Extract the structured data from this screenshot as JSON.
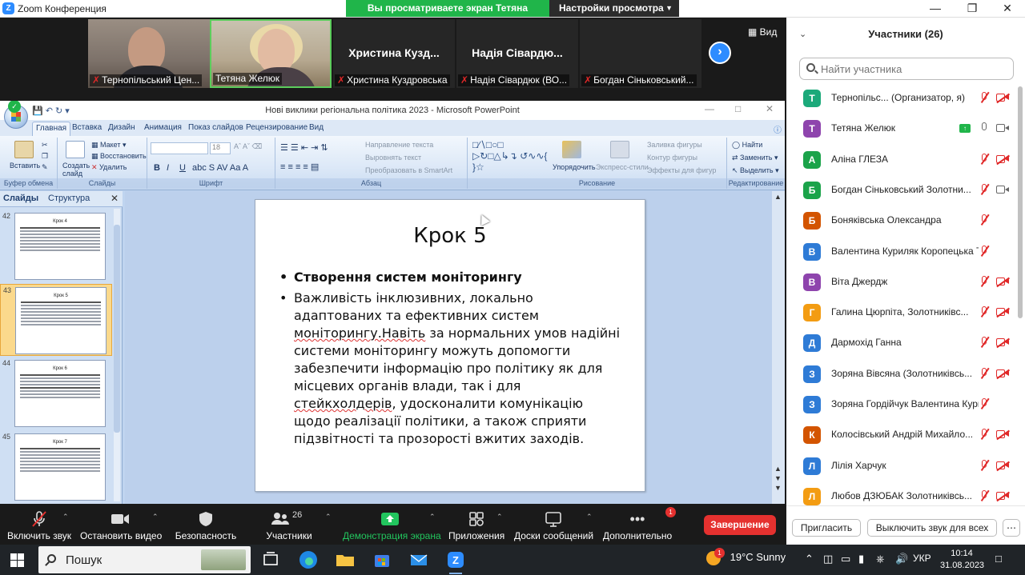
{
  "app": {
    "title": "Zoom Конференция",
    "share_banner": "Вы просматриваете экран Тетяна Желюк",
    "view_settings": "Настройки просмотра"
  },
  "video_strip": {
    "tiles": [
      {
        "name": "Тернопільський Цен..."
      },
      {
        "name": "Тетяна Желюк"
      },
      {
        "name": "Христина Куздровська",
        "big": "Христина Куздровська"
      },
      {
        "name": "Надія Сівардюк (ВО...",
        "big": "Надія Сівардюк ..."
      },
      {
        "name": "Богдан Сіньковський..."
      }
    ],
    "big_name_3": "Христина Кузд...",
    "big_name_4": "Надія Сівардю...",
    "view_label": "Вид"
  },
  "ppt": {
    "window_title": "Нові виклики регіональна політика 2023 - Microsoft PowerPoint",
    "tabs": [
      "Главная",
      "Вставка",
      "Дизайн",
      "Анимация",
      "Показ слайдов",
      "Рецензирование",
      "Вид"
    ],
    "ribbon": {
      "paste": "Вставить",
      "create_slide": "Создать слайд",
      "layout": "Макет",
      "restore": "Восстановить",
      "delete": "Удалить",
      "font_size": "18",
      "text_direction": "Направление текста",
      "align_text": "Выровнять текст",
      "convert_smartart": "Преобразовать в SmartArt",
      "arrange": "Упорядочить",
      "express_styles": "Экспресс-стили",
      "shape_fill": "Заливка фигуры",
      "shape_outline": "Контур фигуры",
      "shape_effects": "Эффекты для фигур",
      "find": "Найти",
      "replace": "Заменить",
      "select": "Выделить",
      "groups": [
        "Буфер обмена",
        "Слайды",
        "Шрифт",
        "Абзац",
        "Рисование",
        "Редактирование"
      ]
    },
    "slides_tabs": [
      "Слайды",
      "Структура"
    ],
    "thumbnails": [
      {
        "num": "42",
        "title": "Крок 4"
      },
      {
        "num": "43",
        "title": "Крок 5"
      },
      {
        "num": "44",
        "title": "Крок 6"
      },
      {
        "num": "45",
        "title": "Крок 7"
      }
    ],
    "slide": {
      "title": "Крок 5",
      "bullet1": "Створення систем моніторингу",
      "bullet2_part1": "Важливість інклюзивних, локально адаптованих та ефективних систем ",
      "bullet2_u1": "моніторингу.Навіть",
      "bullet2_part2": " за нормальних умов надійні системи моніторингу можуть допомогти забезпечити інформацію про політику як для місцевих органів влади, так і для ",
      "bullet2_u2": "стейкхолдерів",
      "bullet2_part3": ", удосконалити комунікацію щодо реалізації політики, а також сприяти підзвітності та прозорості вжитих заходів."
    }
  },
  "participants": {
    "title": "Участники (26)",
    "search_placeholder": "Найти участника",
    "list": [
      {
        "initial": "Т",
        "color": "#1ba97a",
        "name": "Тернопільс... (Организатор, я)",
        "mic": "muted",
        "cam": "muted"
      },
      {
        "initial": "Т",
        "color": "#8e44ad",
        "name": "Тетяна Желюк",
        "mic": "on",
        "cam": "on",
        "sharing": true
      },
      {
        "initial": "А",
        "color": "#1ba34a",
        "name": "Аліна ГЛЕЗА",
        "mic": "muted",
        "cam": "muted"
      },
      {
        "initial": "Б",
        "color": "#1ba34a",
        "name": "Богдан Сіньковський Золотни...",
        "mic": "muted",
        "cam": "on"
      },
      {
        "initial": "Б",
        "color": "#d35400",
        "name": "Боняківська Олександра",
        "mic": "muted",
        "cam": "none"
      },
      {
        "initial": "В",
        "color": "#2e7bd6",
        "name": "Валентина Куриляк Коропецька ТГ",
        "mic": "muted",
        "cam": "none"
      },
      {
        "initial": "В",
        "color": "#8e44ad",
        "name": "Віта Джердж",
        "mic": "muted",
        "cam": "muted"
      },
      {
        "initial": "Г",
        "color": "#f39c12",
        "name": "Галина Цюрпіта, Золотниківс...",
        "mic": "muted",
        "cam": "muted"
      },
      {
        "initial": "Д",
        "color": "#2e7bd6",
        "name": "Дармохід Ганна",
        "mic": "muted",
        "cam": "muted"
      },
      {
        "initial": "З",
        "color": "#2e7bd6",
        "name": "Зоряна Вівсяна (Золотниківсь...",
        "mic": "muted",
        "cam": "muted"
      },
      {
        "initial": "З",
        "color": "#2e7bd6",
        "name": "Зоряна Гордійчук Валентина Кури...",
        "mic": "muted",
        "cam": "none"
      },
      {
        "initial": "К",
        "color": "#d35400",
        "name": "Колосівський Андрій Михайло...",
        "mic": "muted",
        "cam": "muted"
      },
      {
        "initial": "Л",
        "color": "#2e7bd6",
        "name": "Лілія Харчук",
        "mic": "muted",
        "cam": "muted"
      },
      {
        "initial": "Л",
        "color": "#f39c12",
        "name": "Любов ДЗЮБАК Золотниківсь...",
        "mic": "muted",
        "cam": "muted"
      }
    ],
    "invite": "Пригласить",
    "mute_all": "Выключить звук для всех"
  },
  "toolbar": {
    "unmute": "Включить звук",
    "start_video": "Остановить видео",
    "security": "Безопасность",
    "participants": "Участники",
    "participants_count": "26",
    "share_screen": "Демонстрация экрана",
    "apps": "Приложения",
    "whiteboards": "Доски сообщений",
    "more": "Дополнительно",
    "more_badge": "1",
    "end": "Завершение"
  },
  "taskbar": {
    "search": "Пошук",
    "weather": "19°C  Sunny",
    "weather_badge": "1",
    "lang": "УКР",
    "time": "10:14",
    "date": "31.08.2023"
  }
}
